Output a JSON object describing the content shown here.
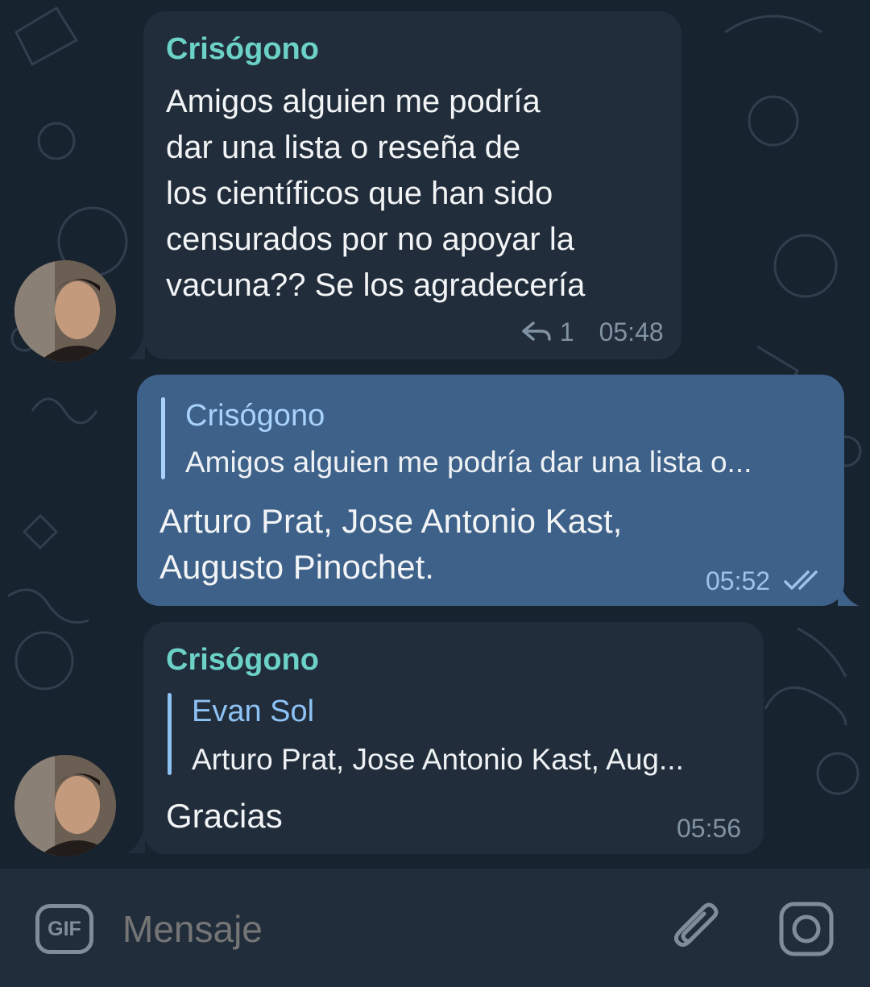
{
  "messages": [
    {
      "sender": "Crisógono",
      "text": "Amigos alguien me podría\ndar una lista o reseña de\nlos científicos que han sido\ncensurados por no apoyar la\nvacuna?? Se los agradecería",
      "replies_count": "1",
      "time": "05:48"
    },
    {
      "quote_name": "Crisógono",
      "quote_text": "Amigos alguien me podría dar una lista o...",
      "text": "Arturo Prat, Jose Antonio Kast,\nAugusto Pinochet.",
      "time": "05:52"
    },
    {
      "sender": "Crisógono",
      "quote_name": "Evan Sol",
      "quote_text": "Arturo Prat, Jose Antonio Kast, Aug...",
      "text": "Gracias",
      "time": "05:56"
    }
  ],
  "composer": {
    "gif_label": "GIF",
    "placeholder": "Mensaje"
  },
  "colors": {
    "background": "#182330",
    "incoming_bubble": "#212d3b",
    "outgoing_bubble": "#3e6189",
    "sender_name": "#6cd1c6",
    "quote_accent": "#8ec2f5"
  },
  "icons": [
    "reply-icon",
    "double-check-icon",
    "attach-icon",
    "camera-icon",
    "avatar"
  ]
}
